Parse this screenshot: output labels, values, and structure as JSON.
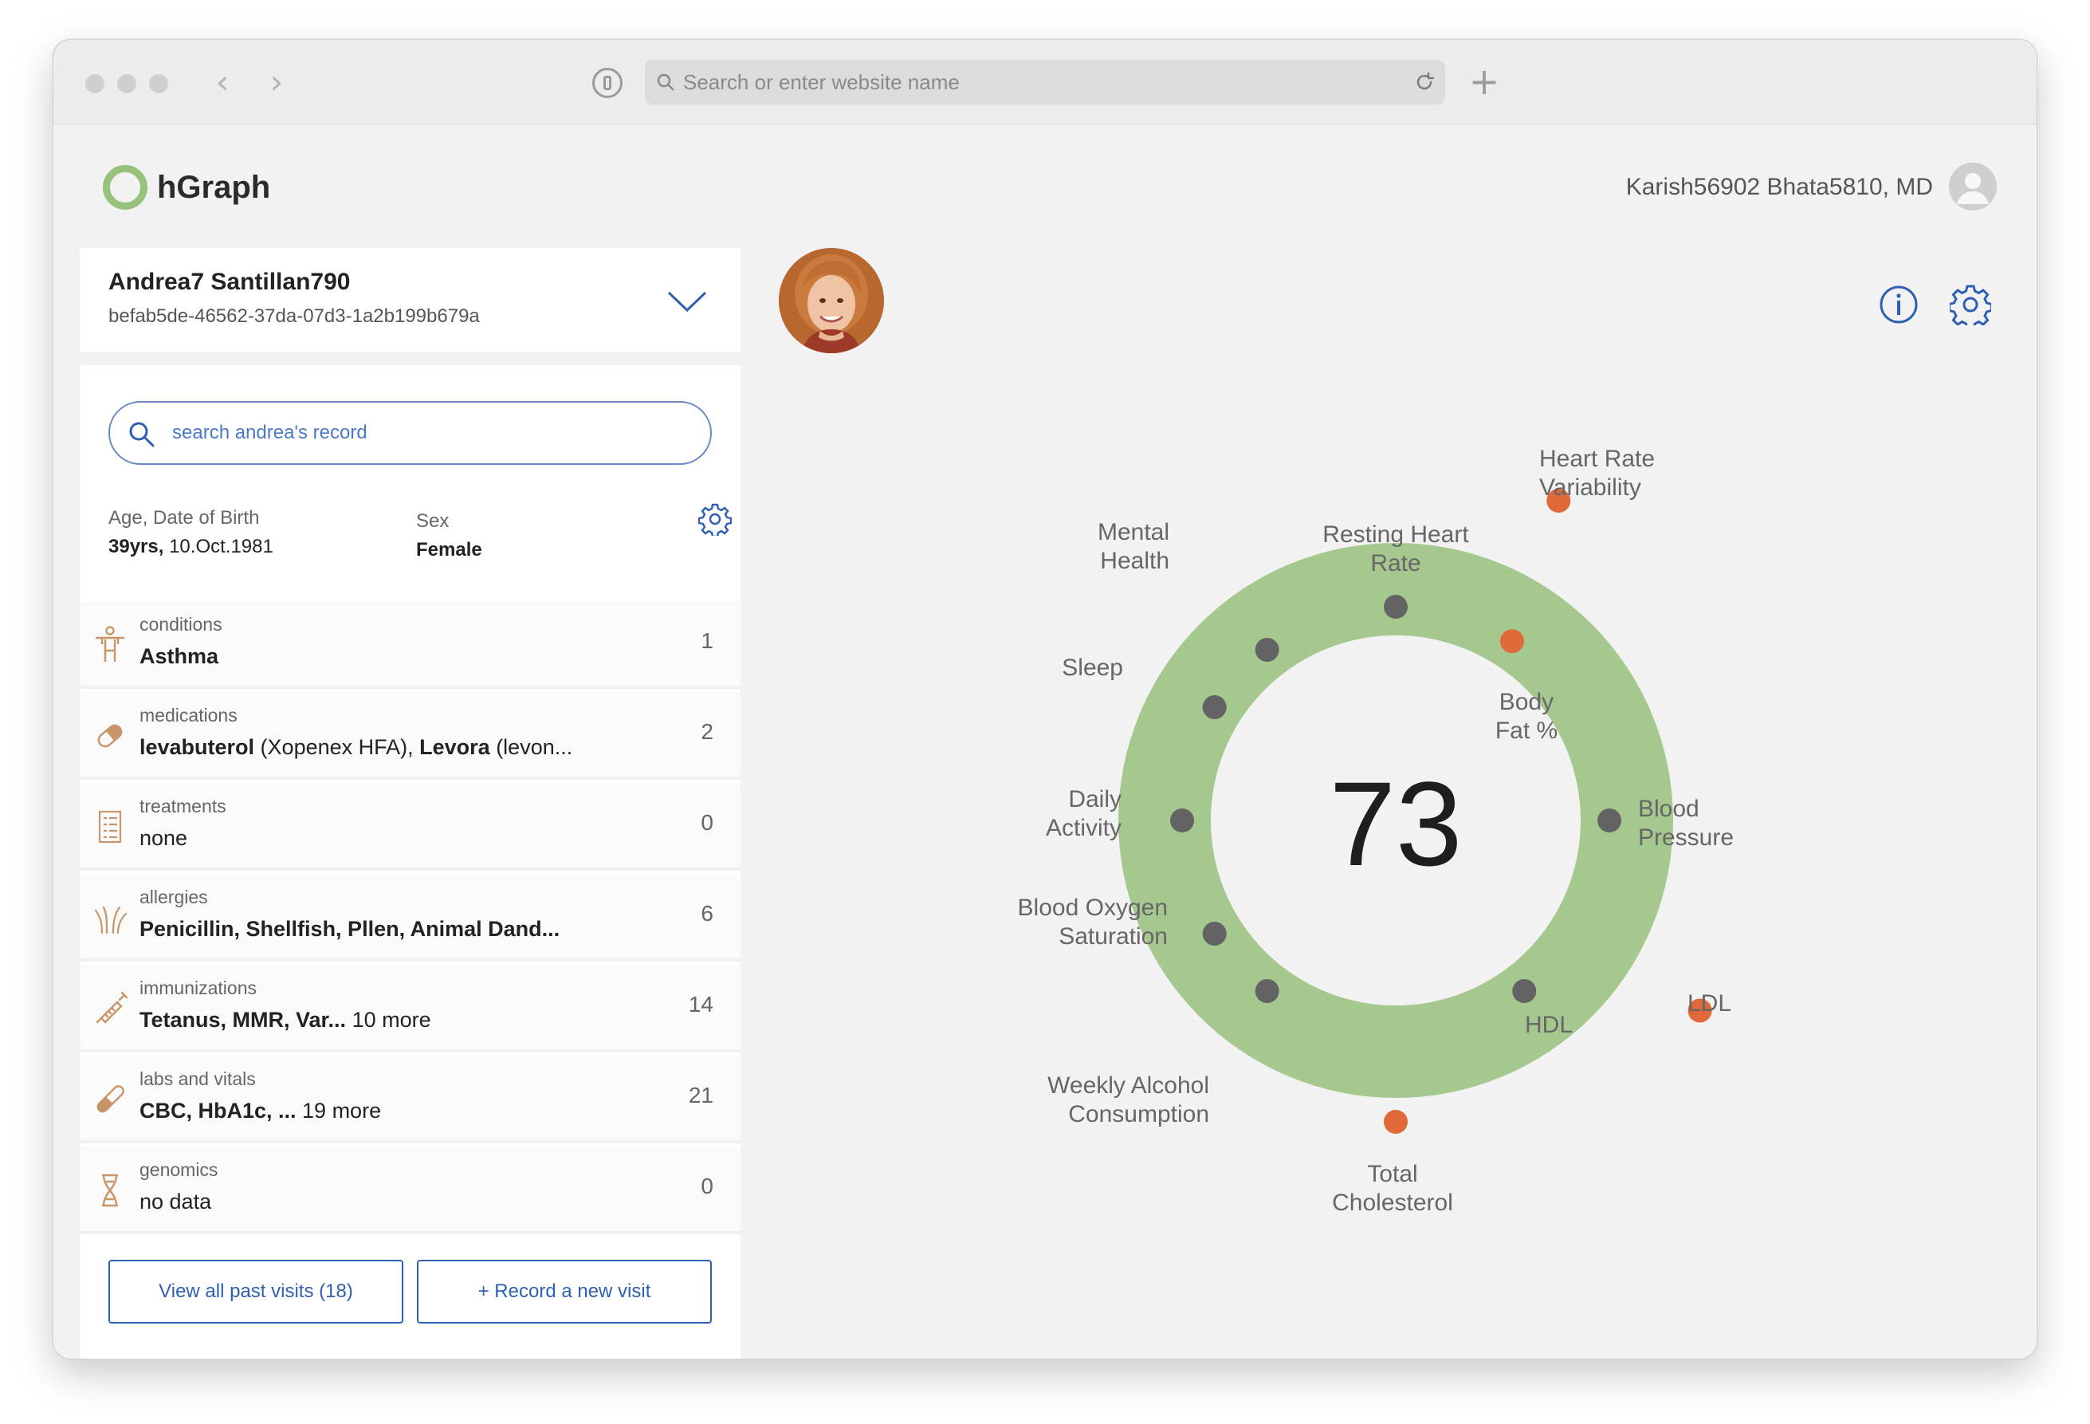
{
  "browser": {
    "address_placeholder": "Search or enter website name"
  },
  "app": {
    "brand": "hGraph",
    "user_name": "Karish56902 Bhata5810, MD",
    "accent": "#96c27b"
  },
  "patient": {
    "name": "Andrea7 Santillan790",
    "id": "befab5de-46562-37da-07d3-1a2b199b679a",
    "search_placeholder": "search andrea's record",
    "age_dob_label": "Age, Date of Birth",
    "age": "39yrs,",
    "dob": "10.Oct.1981",
    "sex_label": "Sex",
    "sex": "Female"
  },
  "categories": [
    {
      "label": "conditions",
      "value": "Asthma",
      "count": "1",
      "icon": "person-icon"
    },
    {
      "label": "medications",
      "value_bold_1": "levabuterol",
      "value_plain_1": " (Xopenex HFA), ",
      "value_bold_2": "Levora",
      "value_plain_2": " (levon...",
      "count": "2",
      "icon": "pill-icon"
    },
    {
      "label": "treatments",
      "value": "none",
      "count": "0",
      "icon": "clipboard-icon"
    },
    {
      "label": "allergies",
      "value": "Penicillin, Shellfish, Pllen, Animal Dand...",
      "count": "6",
      "icon": "allergy-icon"
    },
    {
      "label": "immunizations",
      "value_bold": "Tetanus, MMR, Var...",
      "value_plain": " 10 more",
      "count": "14",
      "icon": "syringe-icon"
    },
    {
      "label": "labs and vitals",
      "value_bold": "CBC, HbA1c, ...",
      "value_plain": " 19 more",
      "count": "21",
      "icon": "test-tube-icon"
    },
    {
      "label": "genomics",
      "value": "no data",
      "count": "0",
      "icon": "dna-icon"
    }
  ],
  "buttons": {
    "past_visits": "View all past visits (18)",
    "new_visit": "+ Record a new visit"
  },
  "hgraph": {
    "score": "73",
    "ring_color": "#a5c88f",
    "healthy_color": "#636363",
    "unhealthy_color": "#e0693a",
    "metrics": [
      {
        "label_lines": [
          "Resting Heart",
          "Rate"
        ],
        "status": "healthy"
      },
      {
        "label_lines": [
          "Heart Rate",
          "Variability"
        ],
        "status": "unhealthy"
      },
      {
        "label_lines": [
          "Body",
          "Fat %"
        ],
        "status": "unhealthy"
      },
      {
        "label_lines": [
          "Blood",
          "Pressure"
        ],
        "status": "healthy"
      },
      {
        "label_lines": [
          "LDL"
        ],
        "status": "unhealthy"
      },
      {
        "label_lines": [
          "HDL"
        ],
        "status": "healthy"
      },
      {
        "label_lines": [
          "Total",
          "Cholesterol"
        ],
        "status": "unhealthy"
      },
      {
        "label_lines": [
          "Weekly Alcohol",
          "Consumption"
        ],
        "status": "healthy"
      },
      {
        "label_lines": [
          "Blood Oxygen",
          "Saturation"
        ],
        "status": "healthy"
      },
      {
        "label_lines": [
          "Daily",
          "Activity"
        ],
        "status": "healthy"
      },
      {
        "label_lines": [
          "Sleep"
        ],
        "status": "healthy"
      },
      {
        "label_lines": [
          "Mental",
          "Health"
        ],
        "status": "healthy"
      }
    ]
  }
}
